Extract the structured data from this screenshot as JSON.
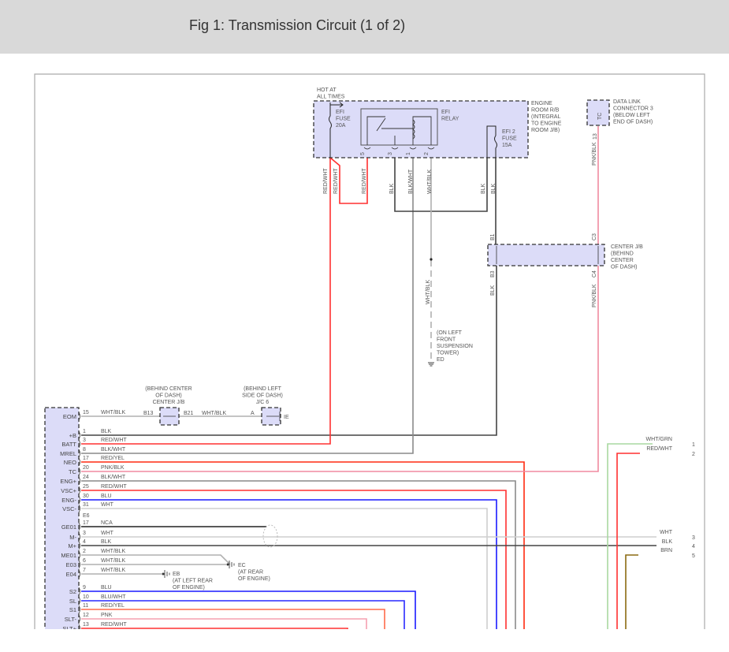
{
  "header": {
    "title": "Fig 1: Transmission Circuit (1 of 2)"
  },
  "colors": {
    "box_fill": "#dcdcf8",
    "BLK": "#444444",
    "RED/WHT": "#ff3030",
    "BLK/WHT": "#8a8a8a",
    "RED/YEL": "#ff2a10",
    "PNK/BLK": "#f08aa0",
    "BLU": "#1a1aff",
    "WHT": "#cfcfcf",
    "NCA": "#222222",
    "WHT/BLK": "#b0b0b0",
    "BLU/WHT": "#2a2aff",
    "PNK": "#f5a0b0",
    "WHT/GRN": "#a8d8a0",
    "BRN": "#8b6a10",
    "S1": "#ff6a4a"
  },
  "engine_room_rb": {
    "hot_label": [
      "HOT AT",
      "ALL TIMES"
    ],
    "label": [
      "ENGINE",
      "ROOM R/B",
      "(INTEGRAL",
      "TO ENGINE",
      "ROOM J/B)"
    ],
    "efi_fuse": [
      "EFI",
      "FUSE",
      "20A"
    ],
    "efi_relay": [
      "EFI",
      "RELAY"
    ],
    "efi2_fuse": [
      "EFI 2",
      "FUSE",
      "15A"
    ],
    "relay_pins": [
      "5",
      "3",
      "1",
      "2"
    ],
    "wire_labels": [
      "RED/WHT",
      "RED/WHT",
      "RED/WHT",
      "BLK",
      "BLK/WHT",
      "WHT/BLK",
      "BLK",
      "BLK"
    ]
  },
  "dlc3": {
    "label": [
      "DATA LINK",
      "CONNECTOR 3",
      "(BELOW LEFT",
      "END OF DASH)"
    ],
    "pin_name": "TC",
    "pin": "13",
    "wire": "PNK/BLK"
  },
  "center_jb_right": {
    "label": [
      "CENTER J/B",
      "(BEHIND",
      "CENTER",
      "OF DASH)"
    ],
    "pins": [
      "B1",
      "B3",
      "C3",
      "C4"
    ],
    "wires": [
      "BLK",
      "PNK/BLK"
    ]
  },
  "ground_ed": {
    "wire": "WHT/BLK",
    "label": [
      "(ON LEFT",
      "FRONT",
      "SUSPENSION",
      "TOWER)",
      "ED"
    ]
  },
  "center_jb_left": {
    "label": [
      "(BEHIND CENTER",
      "OF DASH)",
      "CENTER J/B"
    ],
    "pin_in": "B13",
    "pin_out": "B21",
    "wire": "WHT/BLK"
  },
  "jc6": {
    "label": [
      "(BEHIND LEFT",
      "SIDE OF DASH)",
      "J/C 6"
    ],
    "pin": "A",
    "out": "IE"
  },
  "ground_ec": {
    "label": [
      "EC",
      "(AT REAR",
      "OF ENGINE)"
    ]
  },
  "ground_eb": {
    "label": [
      "EB",
      "(AT LEFT REAR",
      "OF ENGINE)"
    ]
  },
  "ecu": {
    "connector_label": "E6",
    "rows": [
      {
        "pin": "EOM",
        "no": "15",
        "wire": "WHT/BLK"
      },
      {
        "pin": "+B",
        "no": "1",
        "wire": "BLK"
      },
      {
        "pin": "BATT",
        "no": "3",
        "wire": "RED/WHT"
      },
      {
        "pin": "MREL",
        "no": "8",
        "wire": "BLK/WHT"
      },
      {
        "pin": "NEO",
        "no": "17",
        "wire": "RED/YEL"
      },
      {
        "pin": "TC",
        "no": "20",
        "wire": "PNK/BLK"
      },
      {
        "pin": "ENG+",
        "no": "24",
        "wire": "BLK/WHT"
      },
      {
        "pin": "VSC+",
        "no": "25",
        "wire": "RED/WHT"
      },
      {
        "pin": "ENG-",
        "no": "30",
        "wire": "BLU"
      },
      {
        "pin": "VSC-",
        "no": "31",
        "wire": "WHT"
      },
      {
        "pin": "GE01",
        "no": "17",
        "wire": "NCA"
      },
      {
        "pin": "M-",
        "no": "3",
        "wire": "WHT"
      },
      {
        "pin": "M+",
        "no": "4",
        "wire": "BLK"
      },
      {
        "pin": "ME01",
        "no": "2",
        "wire": "WHT/BLK"
      },
      {
        "pin": "E03",
        "no": "6",
        "wire": "WHT/BLK"
      },
      {
        "pin": "E04",
        "no": "7",
        "wire": "WHT/BLK"
      },
      {
        "pin": "S2",
        "no": "9",
        "wire": "BLU"
      },
      {
        "pin": "SL",
        "no": "10",
        "wire": "BLU/WHT"
      },
      {
        "pin": "S1",
        "no": "11",
        "wire": "RED/YEL"
      },
      {
        "pin": "SLT-",
        "no": "12",
        "wire": "PNK"
      },
      {
        "pin": "SLT+",
        "no": "13",
        "wire": "RED/WHT"
      }
    ]
  },
  "right_connector": [
    {
      "no": "1",
      "wire": "WHT/GRN"
    },
    {
      "no": "2",
      "wire": "RED/WHT"
    },
    {
      "no": "3",
      "wire": "WHT"
    },
    {
      "no": "4",
      "wire": "BLK"
    },
    {
      "no": "5",
      "wire": "BRN"
    }
  ]
}
